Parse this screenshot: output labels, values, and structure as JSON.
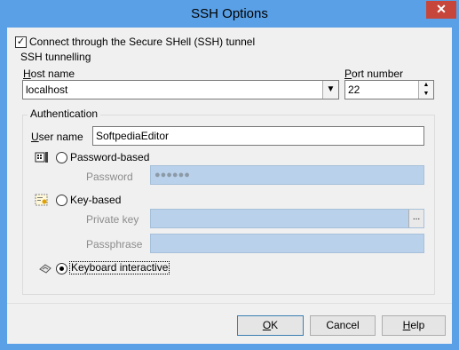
{
  "window": {
    "title": "SSH Options",
    "close_glyph": "✕",
    "accent_color": "#5aa0e6"
  },
  "ssh": {
    "connect_label": "Connect through the Secure SHell (SSH) tunnel",
    "connect_checked": true,
    "tunnelling_legend": "SSH tunnelling",
    "host_label": "Host name",
    "host_value": "localhost",
    "port_label": "Port number",
    "port_value": "22"
  },
  "auth": {
    "legend": "Authentication",
    "user_label": "User name",
    "user_value": "SoftpediaEditor",
    "password_option": "Password-based",
    "password_label": "Password",
    "password_value": "●●●●●●",
    "key_option": "Key-based",
    "private_key_label": "Private key",
    "private_key_value": "",
    "browse_glyph": "...",
    "passphrase_label": "Passphrase",
    "passphrase_value": "",
    "keyboard_option": "Keyboard interactive",
    "selected_method": "Keyboard interactive"
  },
  "buttons": {
    "ok": "OK",
    "cancel": "Cancel",
    "help": "Help"
  }
}
